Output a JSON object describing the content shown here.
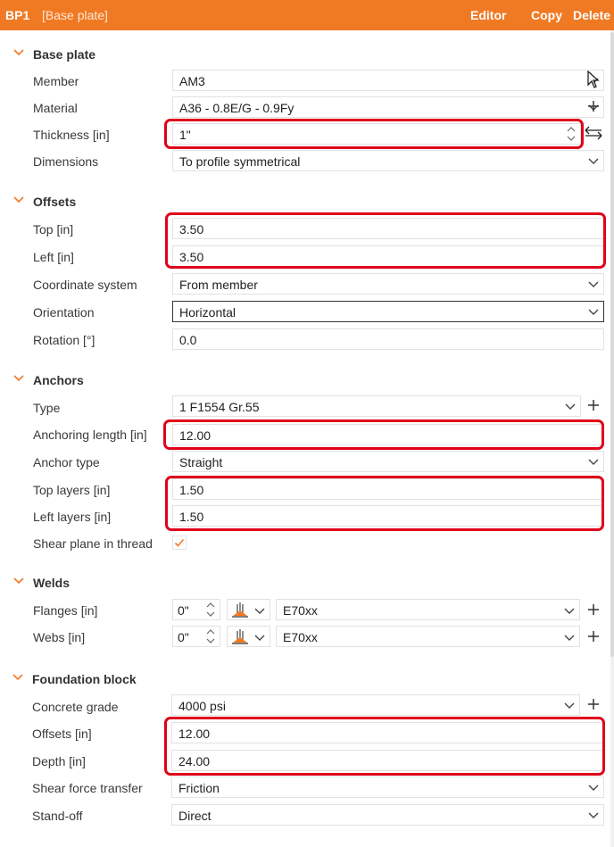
{
  "header": {
    "id": "BP1",
    "name": "[Base plate]",
    "actions": {
      "editor": "Editor",
      "copy": "Copy",
      "delete": "Delete"
    }
  },
  "base_plate": {
    "title": "Base plate",
    "member": {
      "label": "Member",
      "value": "AM3"
    },
    "material": {
      "label": "Material",
      "value": "A36 - 0.8E/G - 0.9Fy"
    },
    "thickness": {
      "label": "Thickness [in]",
      "value": "1\""
    },
    "dimensions": {
      "label": "Dimensions",
      "value": "To profile symmetrical"
    }
  },
  "offsets": {
    "title": "Offsets",
    "top": {
      "label": "Top [in]",
      "value": "3.50"
    },
    "left": {
      "label": "Left [in]",
      "value": "3.50"
    },
    "coordinate_system": {
      "label": "Coordinate system",
      "value": "From member"
    },
    "orientation": {
      "label": "Orientation",
      "value": "Horizontal"
    },
    "rotation": {
      "label": "Rotation [°]",
      "value": "0.0"
    }
  },
  "anchors": {
    "title": "Anchors",
    "type": {
      "label": "Type",
      "value": "1 F1554 Gr.55"
    },
    "anchoring_length": {
      "label": "Anchoring length [in]",
      "value": "12.00"
    },
    "anchor_type": {
      "label": "Anchor type",
      "value": "Straight"
    },
    "top_layers": {
      "label": "Top layers [in]",
      "value": "1.50"
    },
    "left_layers": {
      "label": "Left layers [in]",
      "value": "1.50"
    },
    "shear_plane": {
      "label": "Shear plane in thread",
      "checked": true
    }
  },
  "welds": {
    "title": "Welds",
    "flanges": {
      "label": "Flanges [in]",
      "size": "0\"",
      "material": "E70xx"
    },
    "webs": {
      "label": "Webs [in]",
      "size": "0\"",
      "material": "E70xx"
    }
  },
  "foundation": {
    "title": "Foundation block",
    "concrete_grade": {
      "label": "Concrete grade",
      "value": "4000 psi"
    },
    "offsets": {
      "label": "Offsets [in]",
      "value": "12.00"
    },
    "depth": {
      "label": "Depth [in]",
      "value": "24.00"
    },
    "shear_force_transfer": {
      "label": "Shear force transfer",
      "value": "Friction"
    },
    "stand_off": {
      "label": "Stand-off",
      "value": "Direct"
    }
  },
  "colors": {
    "accent": "#f07a24",
    "highlight": "#e0001a",
    "weld_mark": "#f07a24"
  },
  "icons": [
    "chevron-down-icon",
    "cursor-pick-icon",
    "plus-icon",
    "swap-arrows-icon",
    "spinner-icon",
    "checkmark-icon",
    "weld-symbol-icon"
  ]
}
